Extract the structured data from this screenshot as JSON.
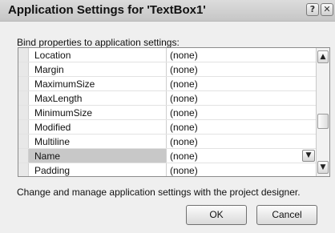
{
  "dialog": {
    "title": "Application Settings for 'TextBox1'",
    "help_glyph": "?",
    "close_glyph": "✕",
    "icons": [
      "help-icon",
      "close-icon",
      "chevron-up-icon",
      "chevron-down-icon"
    ]
  },
  "bind_label": "Bind properties to application settings:",
  "grid": {
    "rows": [
      {
        "name": "Location",
        "value": "(none)"
      },
      {
        "name": "Margin",
        "value": "(none)"
      },
      {
        "name": "MaximumSize",
        "value": "(none)"
      },
      {
        "name": "MaxLength",
        "value": "(none)"
      },
      {
        "name": "MinimumSize",
        "value": "(none)"
      },
      {
        "name": "Modified",
        "value": "(none)"
      },
      {
        "name": "Multiline",
        "value": "(none)"
      },
      {
        "name": "Name",
        "value": "(none)"
      },
      {
        "name": "Padding",
        "value": "(none)"
      }
    ],
    "selected_row": "Name",
    "scroll_up_glyph": "▲",
    "scroll_down_glyph": "▼",
    "dropdown_glyph": "▼"
  },
  "description": "Change and manage application settings with the project designer.",
  "buttons": {
    "ok": "OK",
    "cancel": "Cancel"
  }
}
